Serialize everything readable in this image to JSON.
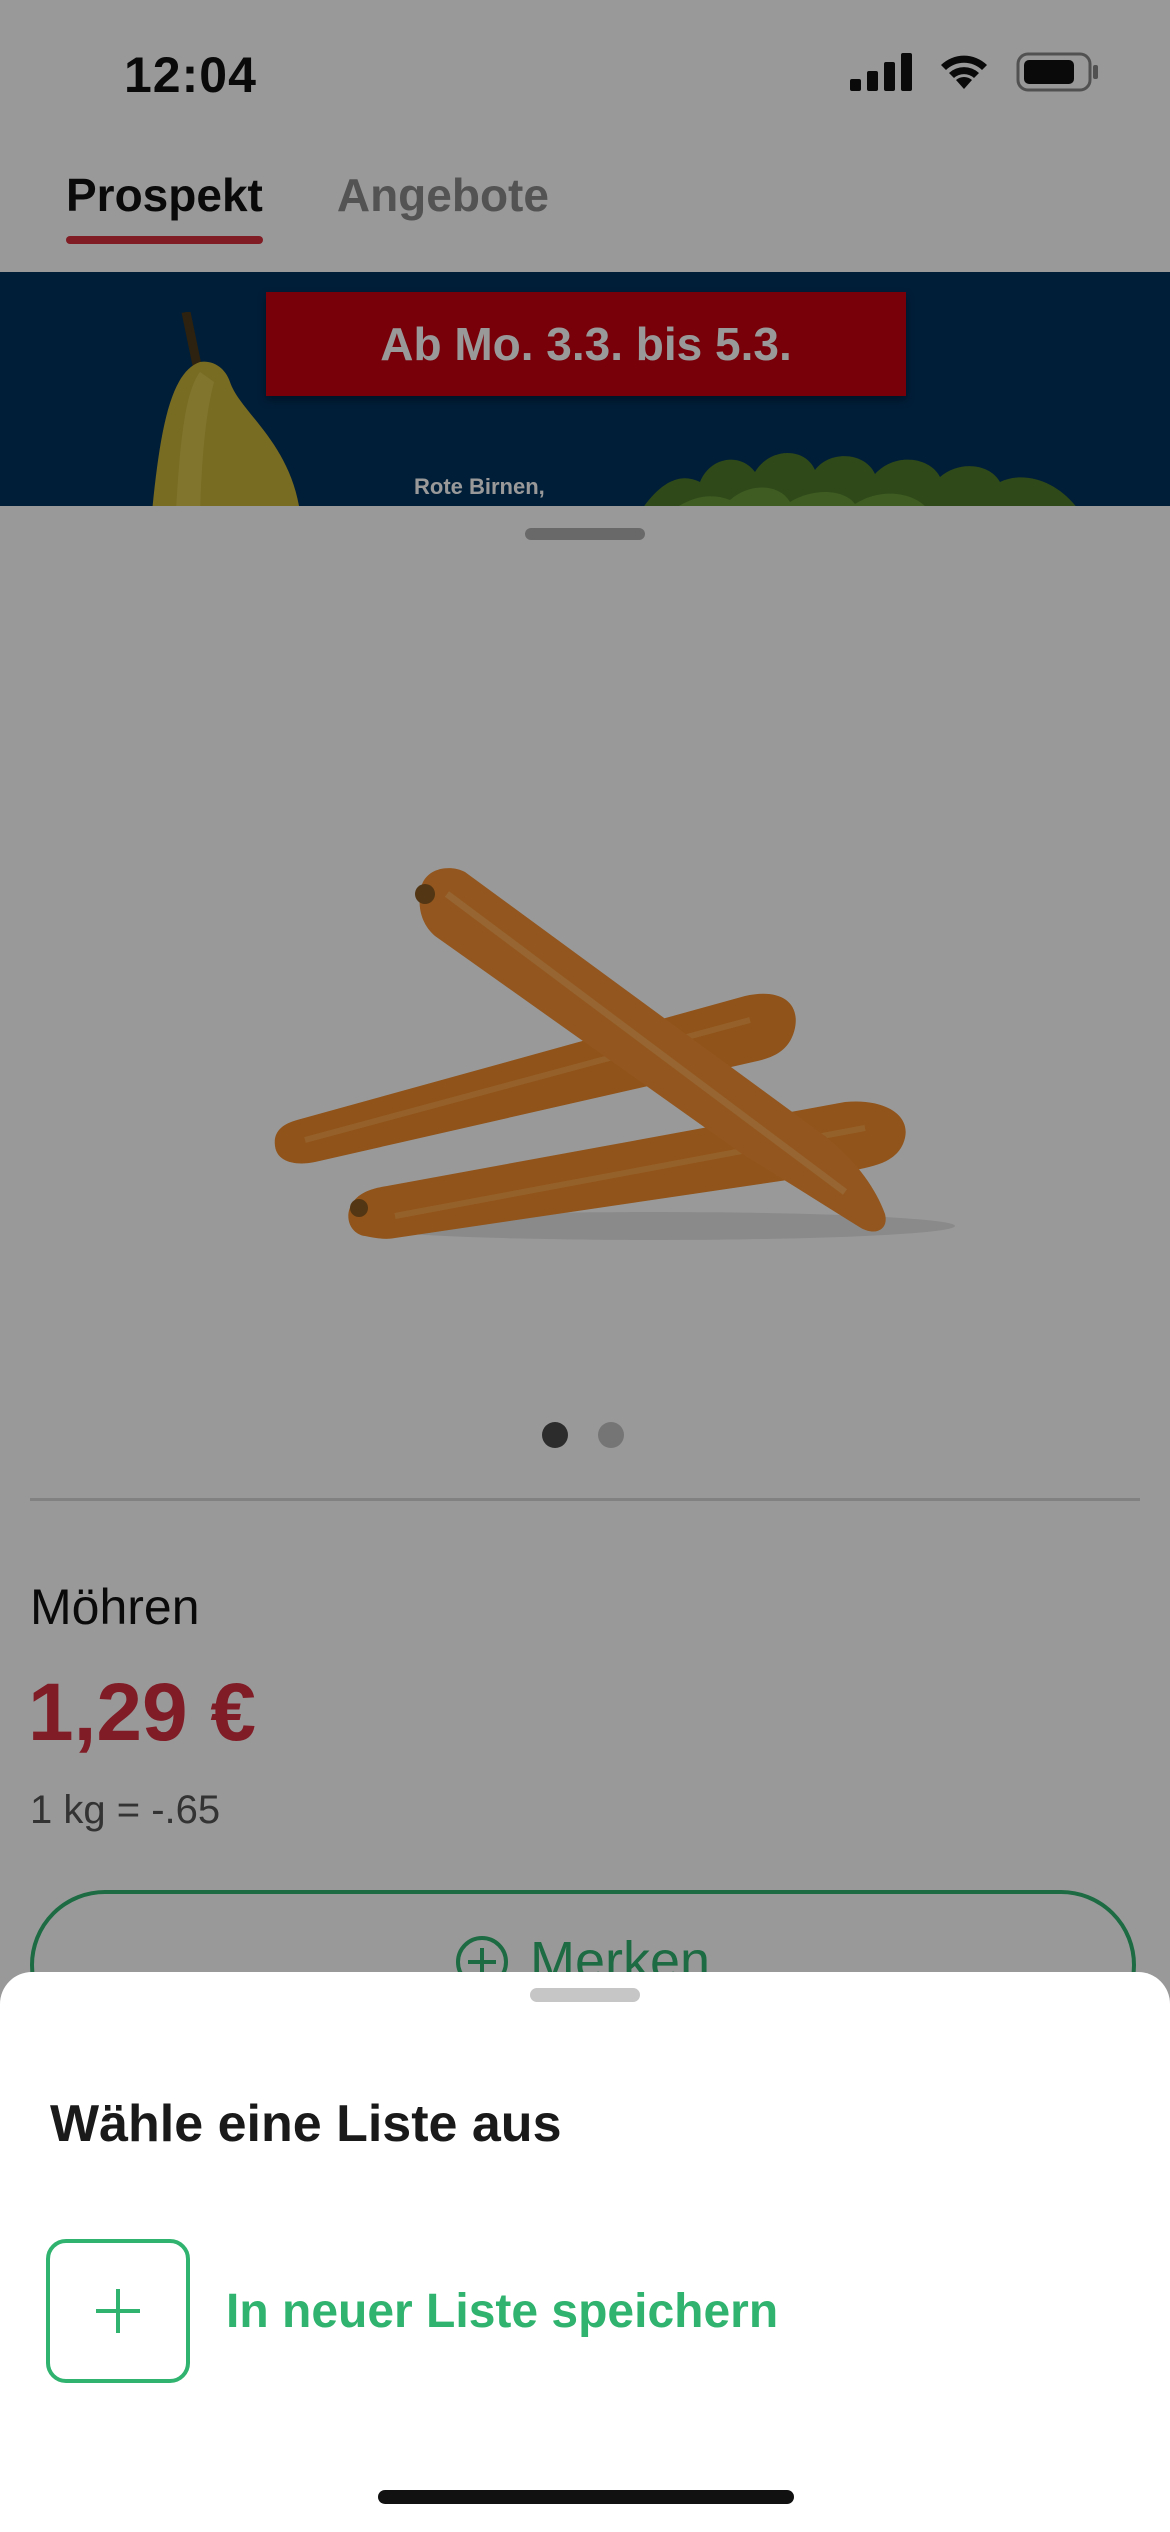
{
  "status_bar": {
    "time": "12:04",
    "icons": [
      "signal-icon",
      "wifi-icon",
      "battery-icon"
    ]
  },
  "tabs": [
    {
      "label": "Prospekt",
      "active": true
    },
    {
      "label": "Angebote",
      "active": false
    }
  ],
  "banner": {
    "date_text": "Ab Mo. 3.3. bis 5.3.",
    "caption": "Rote Birnen,"
  },
  "product": {
    "name": "Möhren",
    "price": "1,29 €",
    "unit_price": "1 kg = -.65",
    "image_pages": 2,
    "current_image": 1,
    "save_button_label": "Merken"
  },
  "bottom_sheet": {
    "title": "Wähle eine Liste aus",
    "new_list_label": "In neuer Liste speichern"
  },
  "colors": {
    "accent_red": "#d63040",
    "accent_green": "#2fb36e",
    "banner_blue": "#00325e",
    "banner_red": "#c8000f"
  }
}
